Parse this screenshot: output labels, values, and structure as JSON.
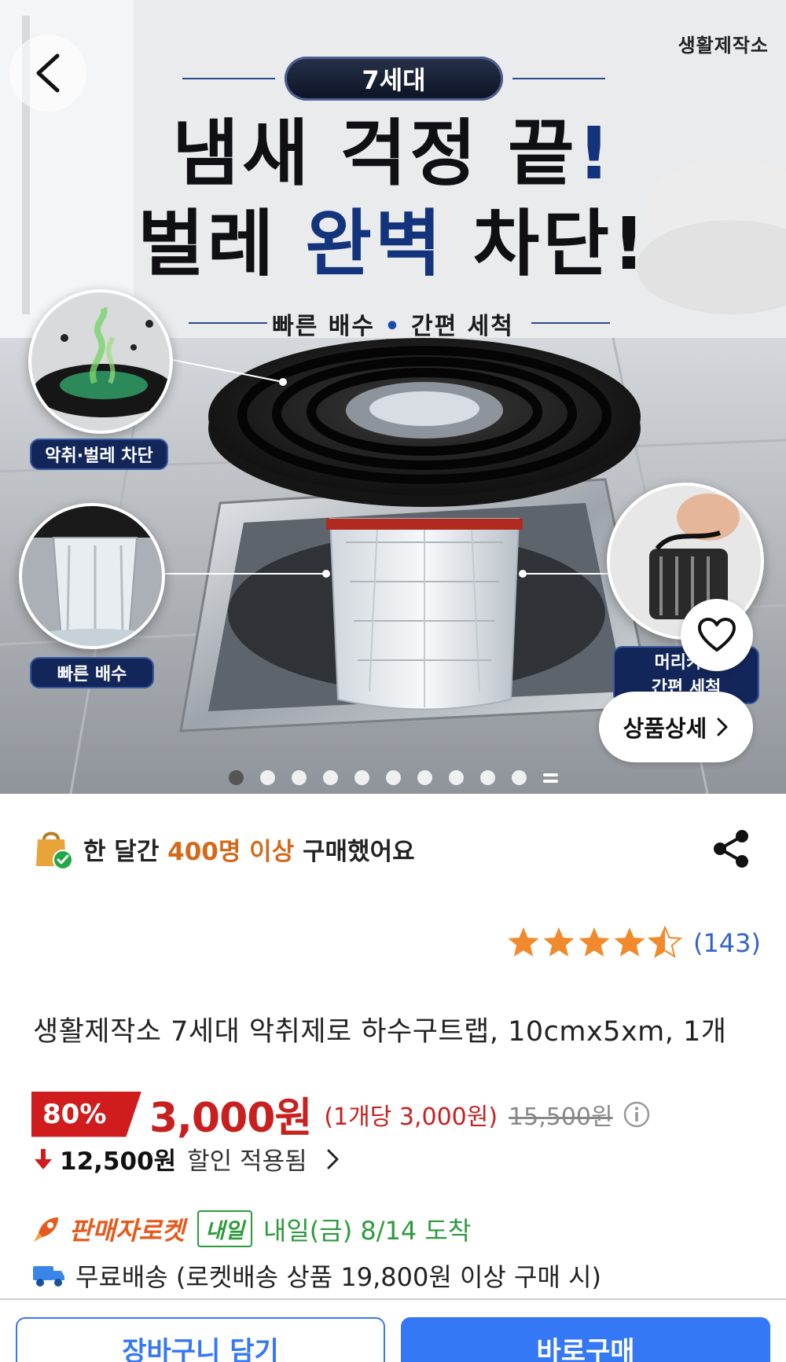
{
  "hero": {
    "brand": "생활제작소",
    "generation": "7세대",
    "headline_line1_part1": "냄새 걱정 끝",
    "headline_line1_part2": "!",
    "headline_line2_part1": "벌레 ",
    "headline_line2_accent": "완벽",
    "headline_line2_part2": " 차단!",
    "sub_part1": "빠른 배수",
    "sub_dot": " • ",
    "sub_part2": "간편 세척",
    "label_odor": "악취·벌레 차단",
    "label_drain": "빠른 배수",
    "label_hair_1": "머리카락",
    "label_hair_2": "간편 세척",
    "detail_button": "상품상세",
    "dots_total": 10,
    "dots_active_index": 0
  },
  "purchase": {
    "prefix": "한 달간 ",
    "highlight": "400명 이상",
    "suffix": " 구매했어요"
  },
  "rating": {
    "stars": 4.5,
    "count": "(143)"
  },
  "product": {
    "title": "생활제작소 7세대 악취제로 하수구트랩, 10cmx5xm, 1개"
  },
  "price": {
    "discount": "80%",
    "sale_price": "3,000원",
    "unit_price": "(1개당 3,000원)",
    "original_price": "15,500원",
    "applied_amount": "12,500원",
    "applied_text": "할인 적용됨"
  },
  "delivery": {
    "seller_rocket": "판매자로켓",
    "tomorrow_badge": "내일",
    "arrival": "내일(금) 8/14 도착",
    "free_shipping": "무료배송 (로켓배송 상품 19,800원 이상 구매 시)"
  },
  "buttons": {
    "cart": "장바구니 담기",
    "buy": "바로구매"
  },
  "colors": {
    "accent_blue": "#3478f6",
    "price_red": "#c8201f",
    "orange": "#d4691b",
    "green": "#2d9a3c",
    "star": "#f08a2c"
  }
}
